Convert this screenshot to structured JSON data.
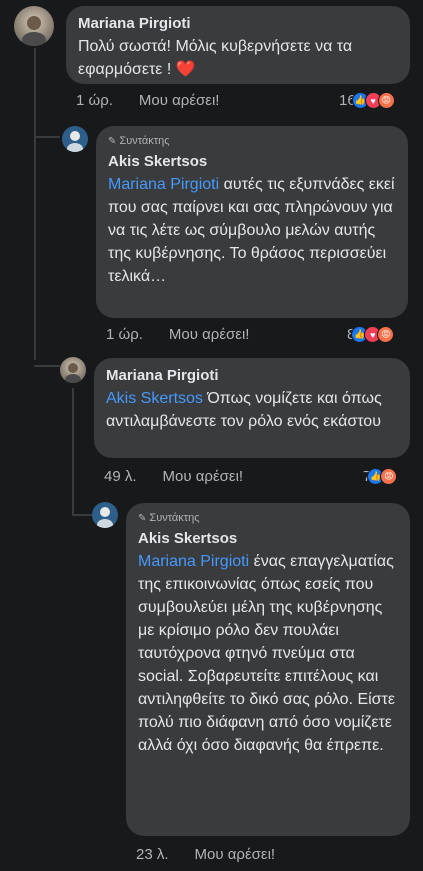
{
  "comments": [
    {
      "author": "Mariana Pirgioti",
      "role": "",
      "mention": "",
      "text": "Πολύ σωστά! Μόλις κυβερνήσετε να τα εφαρμόσετε ! ",
      "emoji": "❤️",
      "time": "1 ώρ.",
      "like_label": "Μου αρέσει!",
      "reaction_count": "16",
      "reactions": [
        "like-icon",
        "love-icon",
        "angry-icon"
      ]
    },
    {
      "author": "Akis Skertsos",
      "role": "Συντάκτης",
      "mention": "Mariana Pirgioti",
      "text": " αυτές τις εξυπνάδες εκεί που σας παίρνει και σας πληρώνουν για να τις λέτε ως σύμβουλο μελών αυτής της κυβέρνησης. Το θράσος περισσεύει τελικά…",
      "time": "1 ώρ.",
      "like_label": "Μου αρέσει!",
      "reaction_count": "8",
      "reactions": [
        "like-icon",
        "love-icon",
        "angry-icon"
      ]
    },
    {
      "author": "Mariana Pirgioti",
      "role": "",
      "mention": "Akis Skertsos",
      "text": " Όπως νομίζετε και όπως αντιλαμβάνεστε τον ρόλο ενός εκάστου",
      "time": "49 λ.",
      "like_label": "Μου αρέσει!",
      "reaction_count": "7",
      "reactions": [
        "like-icon",
        "angry-icon"
      ]
    },
    {
      "author": "Akis Skertsos",
      "role": "Συντάκτης",
      "mention": "Mariana Pirgioti",
      "text": " ένας επαγγελματίας της επικοινωνίας όπως εσείς που συμβουλεύει μέλη της κυβέρνησης με κρίσιμο ρόλο δεν πουλάει ταυτόχρονα φτηνό πνεύμα στα social. Σοβαρευτείτε επιτέλους και αντιληφθείτε το δικό σας ρόλο. Είστε πολύ πιο διάφανη από όσο νομίζετε αλλά όχι όσο διαφανής θα έπρεπε.",
      "time": "23 λ.",
      "like_label": "Μου αρέσει!"
    }
  ],
  "colors": {
    "mention": "#4599ff",
    "bubble": "#3a3b3c",
    "background": "#18191a"
  }
}
